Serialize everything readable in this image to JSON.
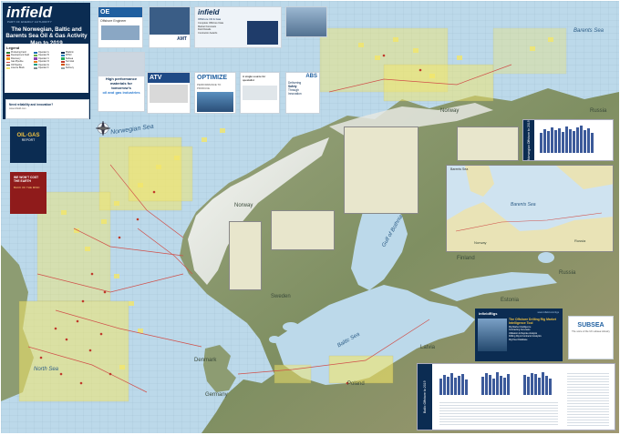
{
  "header": {
    "logo": "infield",
    "logo_sub": "PART OF ENERGY AUTHORITY",
    "title": "The Norwegian, Baltic and Barents Sea Oil & Gas Activity Map to 2019",
    "footer_line1": "Need reliability and innovation?",
    "footer_line2": "www.infield.com"
  },
  "legend": {
    "title": "Legend",
    "col1": [
      "Producing Field",
      "Development Field",
      "Discovery",
      "Gas Pipeline",
      "Oil Pipeline",
      "Licence Block"
    ],
    "col2": [
      "Operator A",
      "Operator B",
      "Operator C",
      "Operator D",
      "Operator E",
      "Operator F"
    ],
    "col3": [
      "Platform",
      "FPSO",
      "Subsea",
      "Terminal",
      "Port",
      "Refinery"
    ]
  },
  "ads_top": {
    "ad1_title": "OE",
    "ad1_sub": "Offshore Engineer",
    "ad3_brand": "infield",
    "ad3_sub": "Offshore Oil & Gas",
    "ad3_list": [
      "Complete Offshore Data",
      "Market Forecasts",
      "Field Details",
      "Contractor Awards"
    ],
    "ad2_brand": "AMT",
    "ad4_brand": "",
    "ad5_brand": "",
    "ad6_line1": "High performance",
    "ad6_line2": "materials for",
    "ad6_line3": "tomorrow's",
    "ad6_line4": "oil and gas industries",
    "ad7_brand": "ATV",
    "ad8_title": "OPTIMIZE",
    "ad8_sub": "PERFORMANCE TO PRODUCE",
    "ad9_title": "A single source for specialist",
    "ad10_brand": "ABS",
    "ad10_line1": "Delivering",
    "ad10_line2": "Safety",
    "ad10_line3": "Through",
    "ad10_line4": "Innovation"
  },
  "left_ads": {
    "oilgas": "OIL·GAS",
    "oilgas_sub": "REPORT",
    "ad_red_line1": "WE WON'T COST THE EARTH",
    "ad_red_line2": "BACK OF THE MIND"
  },
  "seas": {
    "barents": "Barents Sea",
    "norwegian": "Norwegian Sea",
    "north": "North Sea",
    "baltic": "Baltic Sea",
    "bothnia": "Gulf of Bothnia"
  },
  "countries": {
    "norway": "Norway",
    "russia": "Russia",
    "finland": "Finland",
    "sweden": "Sweden",
    "estonia": "Estonia",
    "latvia": "Latvia",
    "russia2": "Russia",
    "denmark": "Denmark",
    "poland": "Poland",
    "germany": "Germany"
  },
  "insets": {
    "barents_inset_title": "Barents Sea",
    "barents_label_sea": "Barents Sea",
    "barents_label_russia": "Russia",
    "barents_label_norway": "Norway",
    "side_panel_top": "Norwegian Offshore to 2019",
    "side_panel_bottom": "Baltic Offshore to 2019"
  },
  "drilling_ad": {
    "brand": "infieldRigs",
    "url": "www.infield.com/rigs",
    "headline": "The Offshore Drilling Rig Market Intelligence Tool",
    "bullets": [
      "Rig Market Intelligence",
      "Contracting Forecasts",
      "Utilisation & Dayrate Analysis",
      "Drilling Rig & Contractor Analytics",
      "Rig Fleet Database"
    ]
  },
  "subsea_ad": {
    "brand": "SUBSEA",
    "sub": "The voice of the UK subsea industry"
  },
  "colors": {
    "sea": "#bfdcec",
    "land": "#8d9c72",
    "block": "#f4e76a",
    "navy": "#0b2c52",
    "pipeline": "#d0504a"
  }
}
